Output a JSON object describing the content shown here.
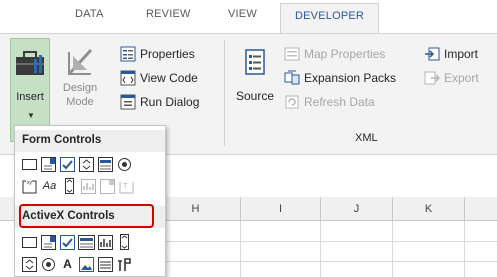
{
  "tabs": [
    "DATA",
    "REVIEW",
    "VIEW",
    "DEVELOPER"
  ],
  "code_group": {
    "insert_label": "Insert",
    "design_mode_line1": "Design",
    "design_mode_line2": "Mode",
    "properties": "Properties",
    "view_code": "View Code",
    "run_dialog": "Run Dialog"
  },
  "xml_group": {
    "source": "Source",
    "map_properties": "Map Properties",
    "expansion_packs": "Expansion Packs",
    "refresh_data": "Refresh Data",
    "import": "Import",
    "export": "Export",
    "label": "XML"
  },
  "insert_menu": {
    "form_controls": "Form Controls",
    "activex_controls": "ActiveX Controls",
    "form_label_glyph": "Aa",
    "activex_label_glyph": "A"
  },
  "columns": [
    "H",
    "I",
    "J",
    "K"
  ],
  "colors": {
    "accent": "#2b579a",
    "highlight": "#d40000",
    "insert_bg": "#c5e0c4"
  },
  "icons": [
    "toolbox-icon",
    "design-mode-icon",
    "properties-icon",
    "view-code-icon",
    "run-dialog-icon",
    "source-icon",
    "map-properties-icon",
    "expansion-packs-icon",
    "refresh-data-icon",
    "import-icon",
    "export-icon"
  ]
}
